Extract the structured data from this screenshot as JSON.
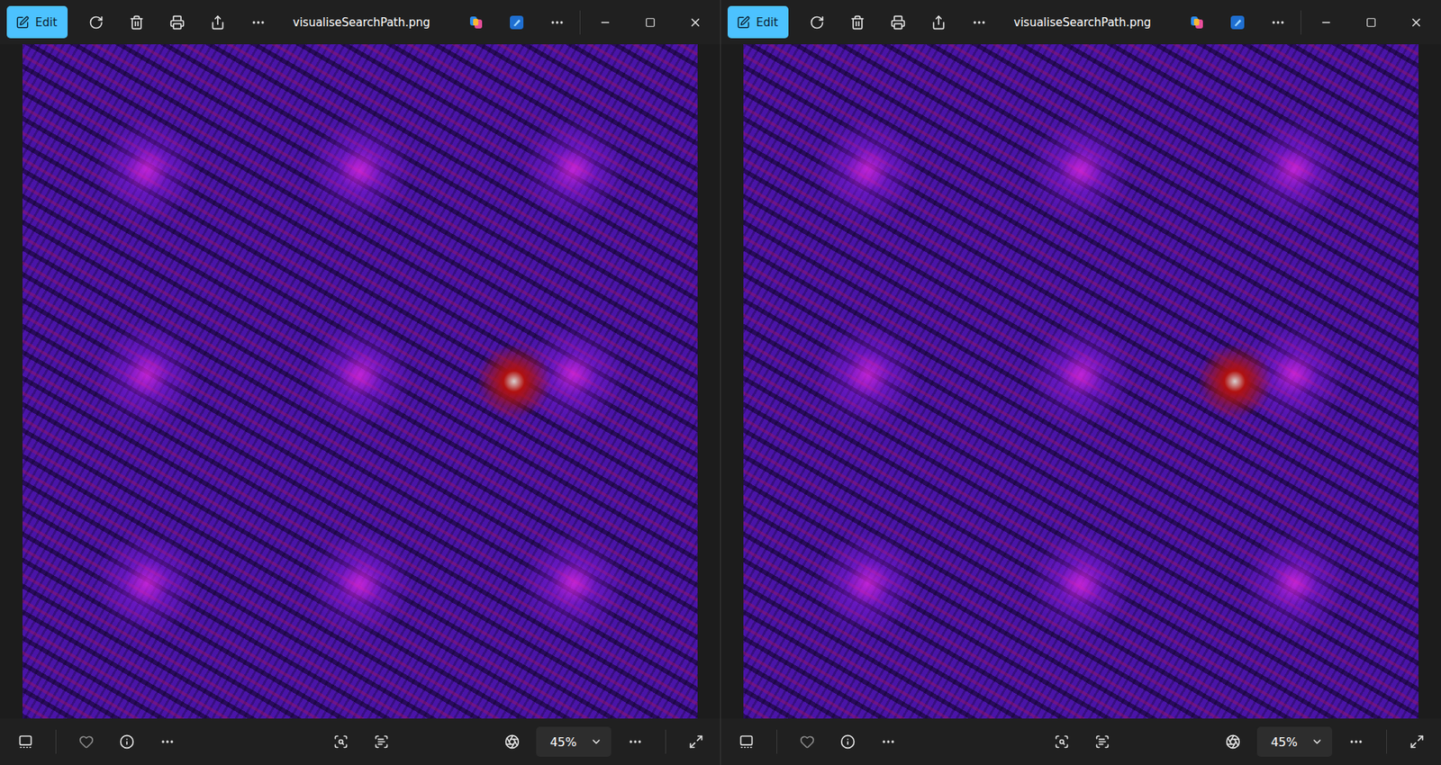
{
  "windows": [
    {
      "title": "visualiseSearchPath.png",
      "edit": {
        "label": "Edit"
      },
      "favorite": false,
      "zoom": "45%"
    },
    {
      "title": "visualiseSearchPath.png",
      "edit": {
        "label": "Edit"
      },
      "favorite": false,
      "zoom": "45%"
    }
  ]
}
